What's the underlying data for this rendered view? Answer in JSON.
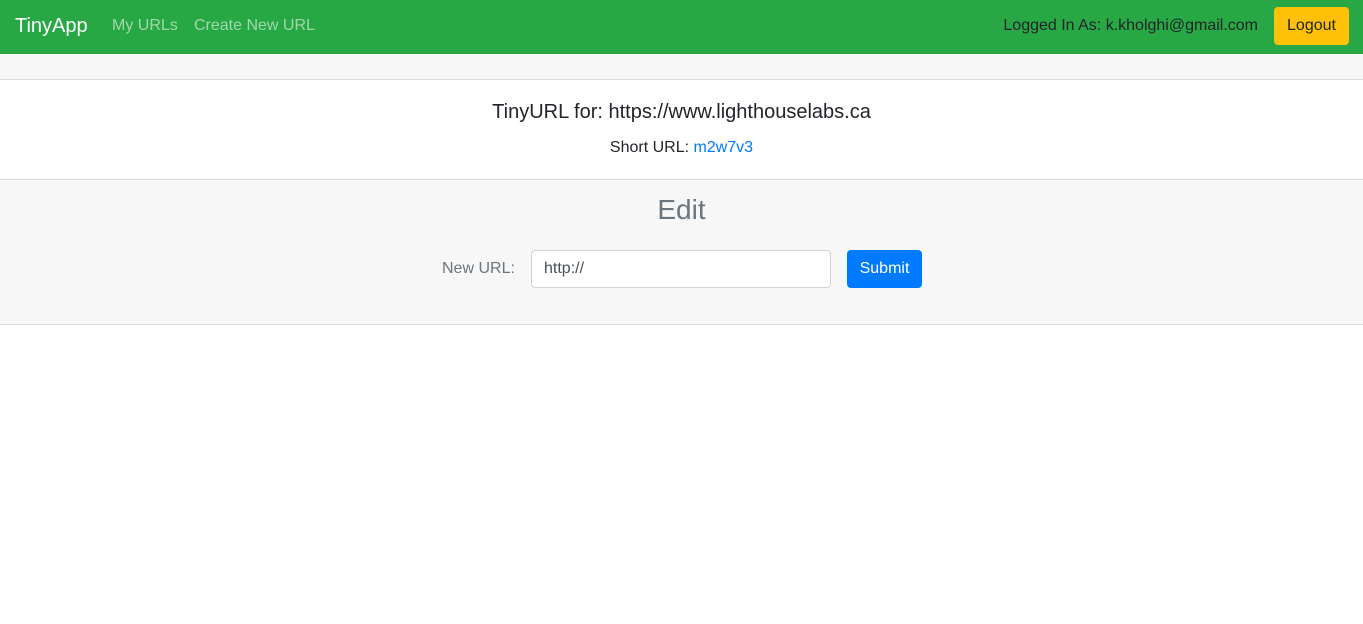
{
  "colors": {
    "navbar_bg": "#28a745",
    "logout_bg": "#ffc107",
    "submit_bg": "#007bff",
    "link": "#007bff"
  },
  "navbar": {
    "brand": "TinyApp",
    "links": [
      {
        "label": "My URLs"
      },
      {
        "label": "Create New URL"
      }
    ],
    "logged_in_text": "Logged In As: k.kholghi@gmail.com",
    "logout_label": "Logout"
  },
  "url_card": {
    "title": "TinyURL for: https://www.lighthouselabs.ca",
    "short_label": "Short URL:",
    "short_code": "m2w7v3"
  },
  "edit": {
    "heading": "Edit",
    "field_label": "New URL:",
    "input_value": "http://",
    "submit_label": "Submit"
  }
}
